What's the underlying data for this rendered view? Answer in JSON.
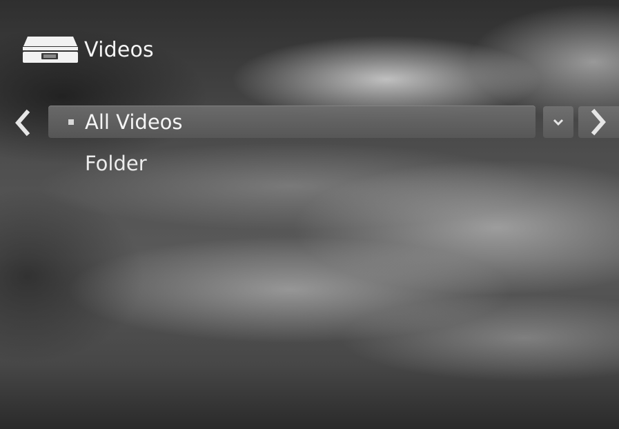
{
  "header": {
    "icon": "drive-icon",
    "title": "Videos"
  },
  "menu": {
    "items": [
      {
        "label": "All Videos",
        "selected": true
      },
      {
        "label": "Folder",
        "selected": false
      }
    ]
  },
  "nav": {
    "prev_icon": "chevron-left-icon",
    "next_icon": "chevron-right-icon",
    "dropdown_icon": "chevron-down-icon"
  },
  "colors": {
    "text": "#f5f5f5",
    "highlight_bar": "#666666",
    "background": "#4a4a4a"
  }
}
